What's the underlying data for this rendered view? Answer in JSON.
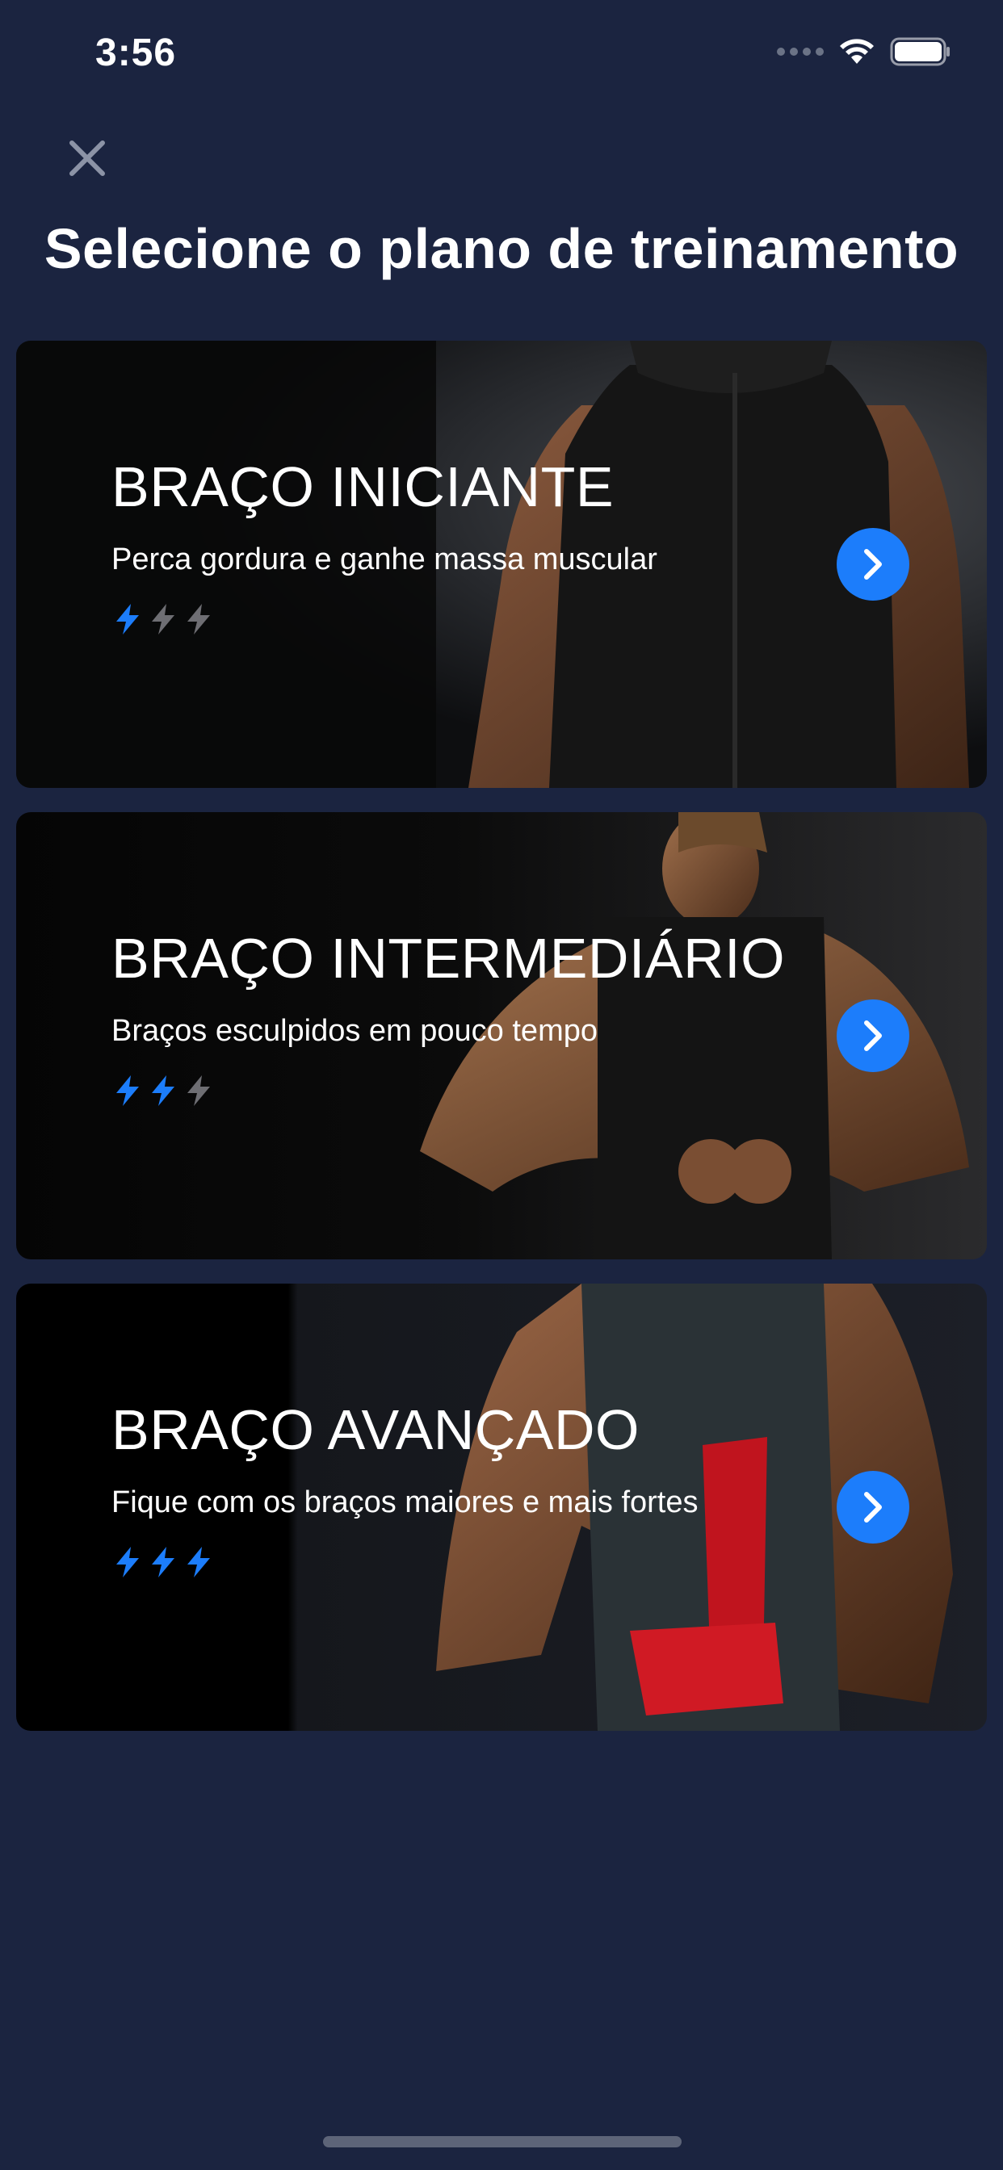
{
  "status_bar": {
    "time": "3:56"
  },
  "header": {
    "title": "Selecione o plano de treinamento"
  },
  "colors": {
    "background": "#1b2440",
    "accent": "#1c7dfb",
    "bolt_active": "#1c7dfb",
    "bolt_inactive": "#6e6e73"
  },
  "icons": {
    "close": "close-icon",
    "arrow": "chevron-right-icon",
    "rating": "lightning-bolt-icon"
  },
  "plans": [
    {
      "title": "BRAÇO INICIANTE",
      "subtitle": "Perca gordura e ganhe massa muscular",
      "difficulty": 1,
      "difficulty_max": 3
    },
    {
      "title": "BRAÇO INTERMEDIÁRIO",
      "subtitle": "Braços esculpidos em pouco tempo",
      "difficulty": 2,
      "difficulty_max": 3
    },
    {
      "title": "BRAÇO AVANÇADO",
      "subtitle": "Fique com os braços maiores e mais fortes",
      "difficulty": 3,
      "difficulty_max": 3
    }
  ]
}
